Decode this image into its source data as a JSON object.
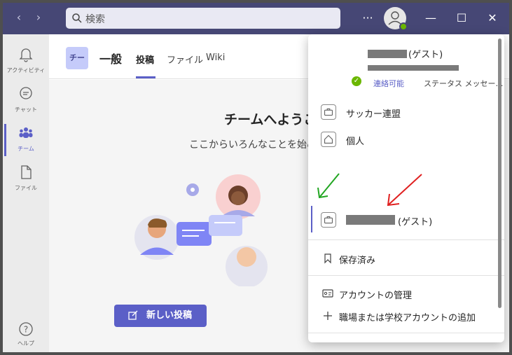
{
  "titlebar": {
    "search_placeholder": "検索",
    "more_icon": "more-icon",
    "minimize": "—",
    "maximize": "☐",
    "close": "✕"
  },
  "rail": [
    {
      "label": "アクティビティ",
      "icon": "bell-icon"
    },
    {
      "label": "チャット",
      "icon": "chat-icon"
    },
    {
      "label": "チーム",
      "icon": "teams-icon"
    },
    {
      "label": "ファイル",
      "icon": "file-icon"
    }
  ],
  "help_label": "ヘルプ",
  "channel": {
    "team_avatar": "チー",
    "name": "一般",
    "tabs": [
      "投稿",
      "ファイル",
      "Wiki"
    ]
  },
  "welcome": {
    "title": "チームへようこ",
    "subtitle": "ここからいろんなことを始め"
  },
  "new_post_label": "新しい投稿",
  "flyout": {
    "guest_suffix": "(ゲスト)",
    "status": "連絡可能",
    "status_message": "ステータス メッセー…",
    "orgs": [
      {
        "name": "サッカー連盟"
      },
      {
        "name": "個人"
      }
    ],
    "active_org_suffix": "(ゲスト)",
    "saved_label": "保存済み",
    "manage_account": "アカウントの管理",
    "add_account": "職場または学校アカウントの追加"
  },
  "colors": {
    "accent": "#5b5fc7",
    "titlebar": "#464775",
    "annotation_green": "#22a622",
    "annotation_red": "#e02020"
  }
}
